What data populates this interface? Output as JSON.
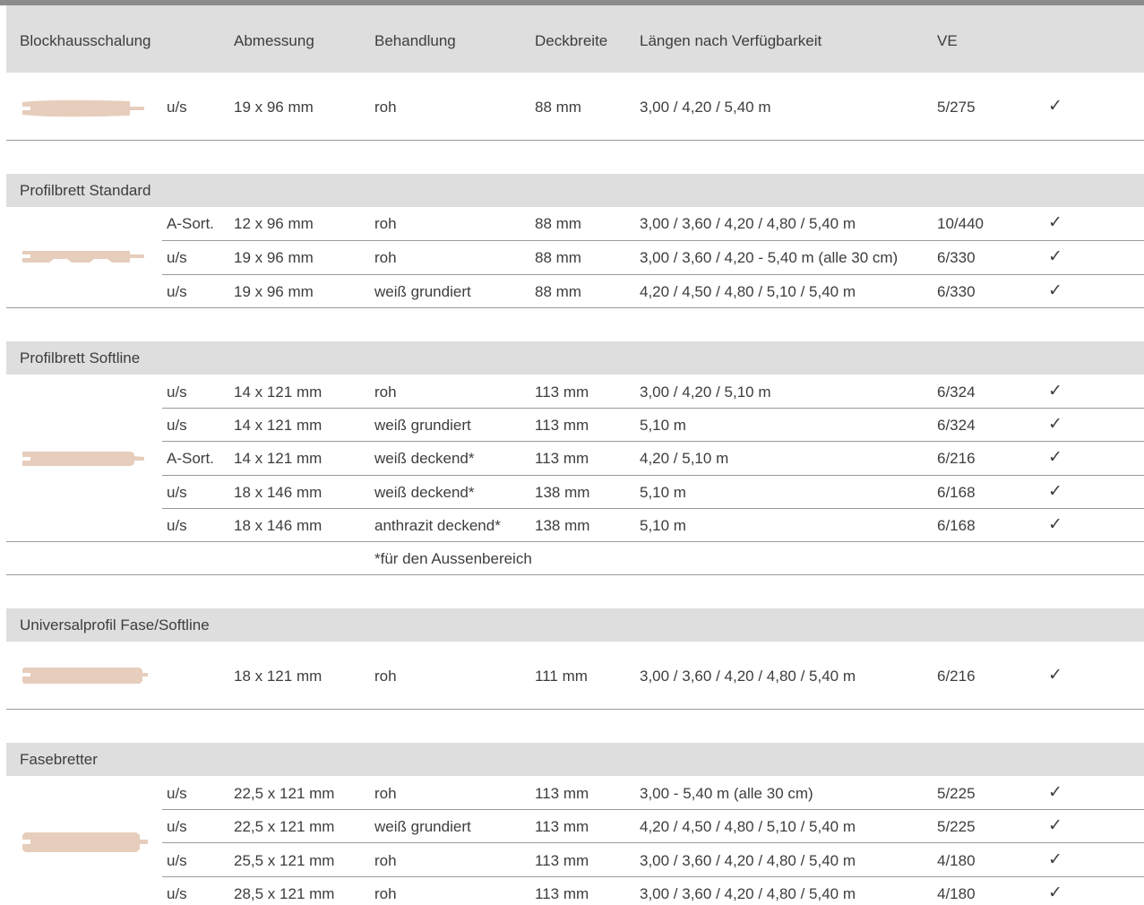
{
  "header": {
    "col1": "Blockhausschalung",
    "col2": "Abmessung",
    "col3": "Behandlung",
    "col4": "Deckbreite",
    "col5": "Längen nach Verfügbarkeit",
    "col6": "VE"
  },
  "check_symbol": "✓",
  "colors": {
    "header_bg": "#dedede",
    "top_bar": "#8c8c8c",
    "board": "#e6cdbc",
    "line": "#9a9a9a"
  },
  "sections": [
    {
      "title": "",
      "rows": [
        {
          "grade": "u/s",
          "size": "19 x 96 mm",
          "treatment": "roh",
          "width": "88 mm",
          "lengths": "3,00 / 4,20 / 5,40 m",
          "ve": "5/275"
        }
      ]
    },
    {
      "title": "Profilbrett Standard",
      "rows": [
        {
          "grade": "A-Sort.",
          "size": "12 x 96 mm",
          "treatment": "roh",
          "width": "88 mm",
          "lengths": "3,00 / 3,60 / 4,20 / 4,80 / 5,40 m",
          "ve": "10/440"
        },
        {
          "grade": "u/s",
          "size": "19 x 96 mm",
          "treatment": "roh",
          "width": "88 mm",
          "lengths": "3,00 / 3,60 / 4,20 - 5,40 m (alle 30 cm)",
          "ve": "6/330"
        },
        {
          "grade": "u/s",
          "size": "19 x 96 mm",
          "treatment": "weiß grundiert",
          "width": "88 mm",
          "lengths": "4,20 / 4,50 / 4,80 / 5,10 / 5,40 m",
          "ve": "6/330"
        }
      ]
    },
    {
      "title": "Profilbrett Softline",
      "rows": [
        {
          "grade": "u/s",
          "size": "14 x 121 mm",
          "treatment": "roh",
          "width": "113 mm",
          "lengths": "3,00 / 4,20 / 5,10 m",
          "ve": "6/324"
        },
        {
          "grade": "u/s",
          "size": "14 x 121 mm",
          "treatment": "weiß grundiert",
          "width": "113 mm",
          "lengths": "5,10 m",
          "ve": "6/324"
        },
        {
          "grade": "A-Sort.",
          "size": "14 x 121 mm",
          "treatment": "weiß deckend*",
          "width": "113 mm",
          "lengths": "4,20 / 5,10 m",
          "ve": "6/216"
        },
        {
          "grade": "u/s",
          "size": "18 x 146 mm",
          "treatment": "weiß deckend*",
          "width": "138 mm",
          "lengths": "5,10 m",
          "ve": "6/168"
        },
        {
          "grade": "u/s",
          "size": "18 x 146 mm",
          "treatment": "anthrazit deckend*",
          "width": "138 mm",
          "lengths": "5,10 m",
          "ve": "6/168"
        }
      ],
      "footnote": "*für den Aussenbereich"
    },
    {
      "title": "Universalprofil Fase/Softline",
      "rows": [
        {
          "grade": "",
          "size": "18 x 121 mm",
          "treatment": "roh",
          "width": "111 mm",
          "lengths": "3,00 / 3,60 / 4,20 / 4,80 / 5,40 m",
          "ve": "6/216"
        }
      ]
    },
    {
      "title": "Fasebretter",
      "rows": [
        {
          "grade": "u/s",
          "size": "22,5 x 121 mm",
          "treatment": "roh",
          "width": "113 mm",
          "lengths": "3,00 - 5,40 m (alle 30 cm)",
          "ve": "5/225"
        },
        {
          "grade": "u/s",
          "size": "22,5 x 121 mm",
          "treatment": "weiß grundiert",
          "width": "113 mm",
          "lengths": "4,20 / 4,50 / 4,80 / 5,10 / 5,40 m",
          "ve": "5/225"
        },
        {
          "grade": "u/s",
          "size": "25,5 x 121 mm",
          "treatment": "roh",
          "width": "113 mm",
          "lengths": "3,00 / 3,60 / 4,20 / 4,80 / 5,40 m",
          "ve": "4/180"
        },
        {
          "grade": "u/s",
          "size": "28,5 x 121 mm",
          "treatment": "roh",
          "width": "113 mm",
          "lengths": "3,00 / 3,60 / 4,20 / 4,80 / 5,40 m",
          "ve": "4/180"
        }
      ]
    }
  ]
}
